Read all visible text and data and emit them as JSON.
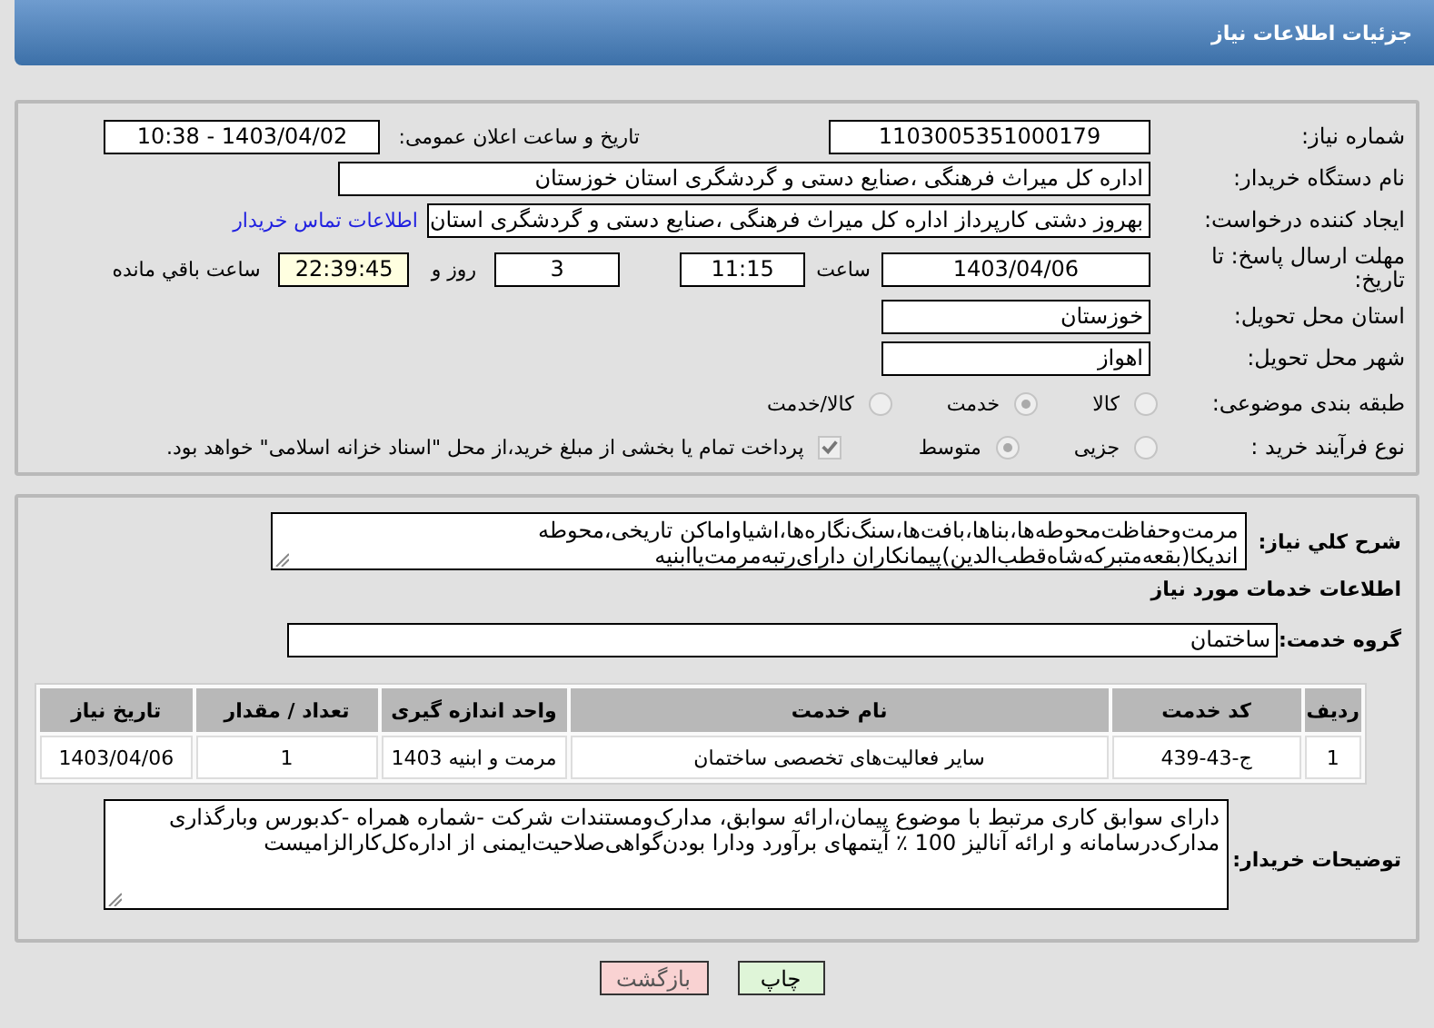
{
  "header": {
    "title": "جزئیات اطلاعات نیاز"
  },
  "details": {
    "need_number": {
      "label": "شماره نیاز:",
      "value": "1103005351000179"
    },
    "announce_datetime": {
      "label": "تاریخ و ساعت اعلان عمومی:",
      "value": "1403/04/02 - 10:38"
    },
    "buyer_org": {
      "label": "نام دستگاه خریدار:",
      "value": "اداره کل میراث فرهنگی ،صنایع دستی و گردشگری استان خوزستان"
    },
    "requester": {
      "label": "ایجاد کننده درخواست:",
      "value": "بهروز دشتی کارپرداز اداره کل میراث فرهنگی ،صنایع دستی و گردشگری استان",
      "link": "اطلاعات تماس خریدار"
    },
    "deadline": {
      "label": "مهلت ارسال پاسخ: تا تاریخ:",
      "date": "1403/04/06",
      "time_label": "ساعت",
      "time": "11:15",
      "days": "3",
      "days_label": "روز و",
      "remaining": "22:39:45",
      "remaining_label": "ساعت باقي مانده"
    },
    "province": {
      "label": "استان محل تحویل:",
      "value": "خوزستان"
    },
    "city": {
      "label": "شهر محل تحویل:",
      "value": "اهواز"
    },
    "category": {
      "label": "طبقه بندی موضوعی:",
      "options": [
        {
          "label": "کالا",
          "selected": false
        },
        {
          "label": "خدمت",
          "selected": true
        },
        {
          "label": "کالا/خدمت",
          "selected": false
        }
      ]
    },
    "process": {
      "label": "نوع فرآیند خرید :",
      "options": [
        {
          "label": "جزیی",
          "selected": false
        },
        {
          "label": "متوسط",
          "selected": true
        }
      ],
      "payment": {
        "checked": true,
        "label": "پرداخت تمام یا بخشی از مبلغ خرید،از محل \"اسناد خزانه اسلامی\" خواهد بود."
      }
    }
  },
  "needs": {
    "summary": {
      "label": "شرح کلي نياز:",
      "value": "مرمت‌وحفاظت‌محوطه‌ها،بناها،بافت‌ها،سنگ‌نگاره‌ها،اشیاواماکن تاریخی،محوطه اندیکا(بقعه‌متبرکه‌شاه‌قطب‌الدین)پیمانکاران دارای‌رتبه‌مرمت‌یاابنیه"
    },
    "section_title": "اطلاعات خدمات مورد نیاز",
    "service_group": {
      "label": "گروه خدمت:",
      "value": "ساختمان"
    },
    "table": {
      "columns": [
        "ردیف",
        "کد خدمت",
        "نام خدمت",
        "واحد اندازه گیری",
        "تعداد / مقدار",
        "تاریخ نیاز"
      ],
      "rows": [
        [
          "1",
          "ج-43-439",
          "سایر فعالیت‌های تخصصی ساختمان",
          "مرمت و ابنیه 1403",
          "1",
          "1403/04/06"
        ]
      ]
    },
    "buyer_notes": {
      "label": "توضیحات خریدار:",
      "value": "دارای سوابق کاری مرتبط با موضوع پیمان،ارائه سوابق، مدارک‌ومستندات شرکت -شماره همراه -کدبورس وبارگذاری مدارک‌درسامانه و ارائه آنالیز 100 ٪ آیتمهای برآورد ودارا بودن‌گواهی‌صلاحیت‌ایمنی از اداره‌کل‌کارالزامیست"
    }
  },
  "buttons": [
    {
      "kind": "print",
      "label": "چاپ"
    },
    {
      "kind": "back",
      "label": "بازگشت"
    }
  ]
}
